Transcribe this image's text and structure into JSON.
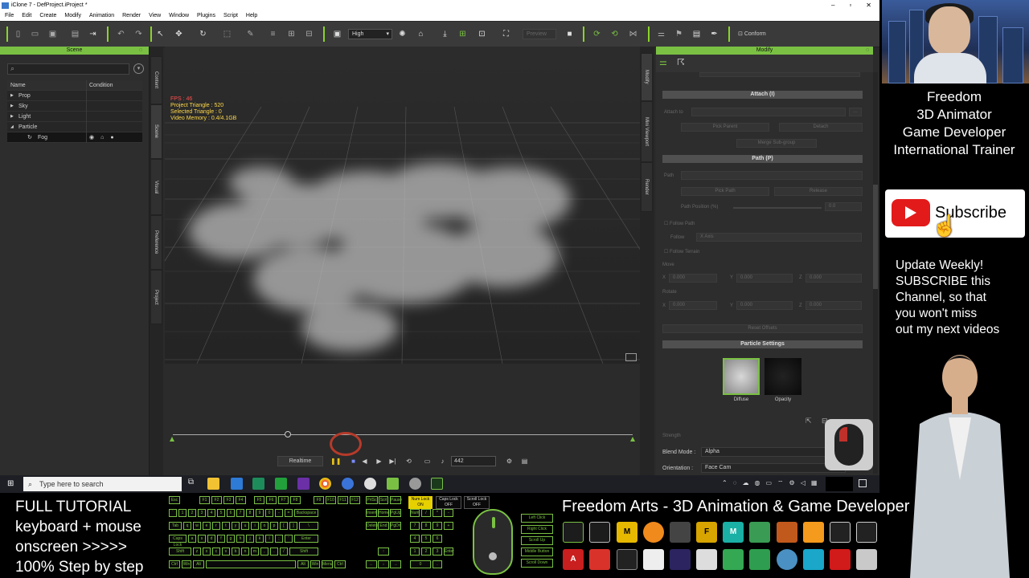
{
  "app": {
    "title": "iClone 7 - DefProject.iProject *",
    "menu": [
      "File",
      "Edit",
      "Create",
      "Modify",
      "Animation",
      "Render",
      "View",
      "Window",
      "Plugins",
      "Script",
      "Help"
    ],
    "win_controls": [
      "–",
      "▫",
      "✕"
    ],
    "quality": "High",
    "preview_label": "Preview",
    "conform_label": "Conform"
  },
  "scene_panel": {
    "title": "Scene",
    "columns": [
      "Name",
      "Condition"
    ],
    "rows": [
      {
        "label": "Prop",
        "arrow": "▶"
      },
      {
        "label": "Sky",
        "arrow": "▶"
      },
      {
        "label": "Light",
        "arrow": "▶"
      },
      {
        "label": "Particle",
        "arrow": "◢"
      },
      {
        "label": "Fog",
        "arrow": ""
      }
    ]
  },
  "left_tabs": [
    "Content",
    "Scene",
    "Visual",
    "Preference",
    "Project"
  ],
  "right_tabs": [
    "Modify",
    "Mini Viewport",
    "Render"
  ],
  "viewport": {
    "fps": "FPS : 46",
    "project_triangle": "Project Triangle : 520",
    "selected_triangle": "Selected Triangle : 0",
    "video_memory": "Video Memory : 0.4/4.1GB"
  },
  "timeline": {
    "realtime": "Realtime",
    "frame": "442",
    "knob_fraction": 0.25
  },
  "modify_panel": {
    "title": "Modify",
    "attach_header": "Attach (I)",
    "attach_to": "Attach to",
    "pick_parent": "Pick Parent",
    "detach": "Detach",
    "merge_subgroup": "Merge Sub-group",
    "path_header": "Path (P)",
    "path_label": "Path",
    "pick_path": "Pick Path",
    "release": "Release",
    "path_position": "Path Position (%)",
    "path_position_value": "0.0",
    "follow_path": "Follow Path",
    "follow_label": "Follow",
    "follow_value": "X Axis",
    "follow_terrain": "Follow Terrain",
    "move_label": "Move",
    "rotate_label": "Rotate",
    "axis_values": [
      "0.000",
      "0.000",
      "0.000"
    ],
    "axes": [
      "X",
      "Y",
      "Z"
    ],
    "reset_offsets": "Reset Offsets",
    "particle_header": "Particle Settings",
    "diffuse": "Diffuse",
    "opacity": "Opacity",
    "strength": "Strength",
    "blend_mode_label": "Blend Mode :",
    "blend_mode_value": "Alpha",
    "orientation_label": "Orientation :",
    "orientation_value": "Face Cam"
  },
  "taskbar": {
    "search_placeholder": "Type here to search"
  },
  "overlay": {
    "bio": [
      "Freedom",
      "3D Animator",
      "Game Developer",
      "International Trainer"
    ],
    "subscribe": "Subscribe",
    "update": [
      "Update Weekly!",
      "SUBSCRIBE this",
      "Channel, so that",
      "you won't miss",
      "out my next videos"
    ],
    "tutorial": [
      "FULL TUTORIAL",
      "keyboard + mouse",
      "onscreen >>>>>",
      "100% Step by step"
    ],
    "brand_title": "Freedom Arts - 3D Animation & Game Developer"
  },
  "keyboard": {
    "num_lock": "Num Lock\nON",
    "caps_lock": "Caps Lock\nOFF",
    "scroll_lock": "Scroll Lock\nOFF",
    "mouse_labels": [
      "Left Click",
      "Right Click",
      "Scroll Up",
      "Middle Button",
      "Scroll Down"
    ]
  }
}
